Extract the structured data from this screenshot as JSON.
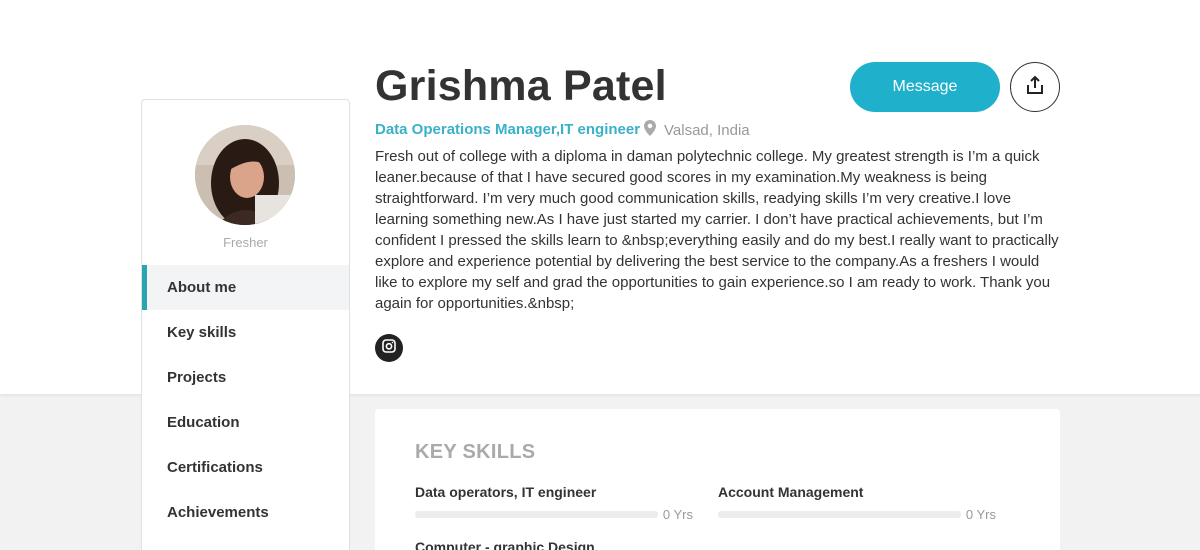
{
  "profile": {
    "name": "Grishma Patel",
    "role": "Data Operations Manager,IT engineer",
    "location": "Valsad, India",
    "status": "Fresher",
    "bio": "Fresh out of college with a diploma in daman polytechnic college. My greatest strength is I’m a quick leaner.because of that I have secured good scores in my examination.My weakness is being straightforward. I’m very much good communication skills, readying skills I’m very creative.I love learning something new.As I have just started my carrier. I don’t have practical achievements, but I’m confident I pressed the skills learn to &nbsp;everything easily and do my best.I really want to practically explore and experience potential by delivering the best service to the company.As a freshers I would like to explore my self and grad the opportunities to gain experience.so I am ready to work. Thank you again for opportunities.&nbsp;"
  },
  "actions": {
    "message_label": "Message",
    "share_icon": "share-icon"
  },
  "icons": {
    "location": "map-pin-icon",
    "social": "instagram-icon"
  },
  "nav": {
    "items": [
      {
        "label": "About me",
        "active": true
      },
      {
        "label": "Key skills",
        "active": false
      },
      {
        "label": "Projects",
        "active": false
      },
      {
        "label": "Education",
        "active": false
      },
      {
        "label": "Certifications",
        "active": false
      },
      {
        "label": "Achievements",
        "active": false
      }
    ]
  },
  "skills": {
    "title": "KEY SKILLS",
    "items": [
      {
        "name": "Data operators, IT engineer",
        "years": "0 Yrs",
        "level": 0
      },
      {
        "name": "Account Management",
        "years": "0 Yrs",
        "level": 0
      },
      {
        "name": "Computer - graphic Design",
        "years": "",
        "level": 0
      }
    ]
  },
  "colors": {
    "accent": "#1fb0cc",
    "role_text": "#3ab1c8",
    "nav_active_bar": "#2aa3b3"
  }
}
